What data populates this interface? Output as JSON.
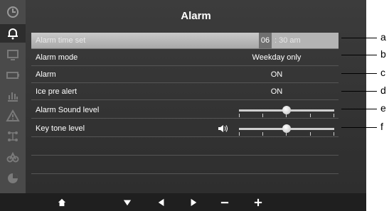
{
  "window": {
    "title": "Alarm"
  },
  "sidebar": {
    "icons": [
      "clock-icon",
      "bell-icon",
      "display-icon",
      "battery-icon",
      "chart-icon",
      "warning-icon",
      "network-icon",
      "tools-icon",
      "pie-icon"
    ],
    "active": "bell-icon"
  },
  "rows": [
    {
      "label": "Alarm time set",
      "hour": "06",
      "rest": ": 30  am",
      "selected": true
    },
    {
      "label": "Alarm mode",
      "value": "Weekday only"
    },
    {
      "label": "Alarm",
      "value": "ON"
    },
    {
      "label": "Ice pre alert",
      "value": "ON"
    },
    {
      "label": "Alarm Sound level",
      "level": 0.5
    },
    {
      "label": "Key tone level",
      "level": 0.5
    }
  ],
  "bottom_bar": {
    "buttons": [
      "home-icon",
      "down-arrow-icon",
      "left-arrow-icon",
      "right-arrow-icon",
      "minus-icon",
      "plus-icon"
    ]
  },
  "callouts": [
    "a",
    "b",
    "c",
    "d",
    "e",
    "f"
  ],
  "colors": {
    "screen": "#333333",
    "selected_row": "#b8b8b8",
    "text": "#ffffff"
  }
}
